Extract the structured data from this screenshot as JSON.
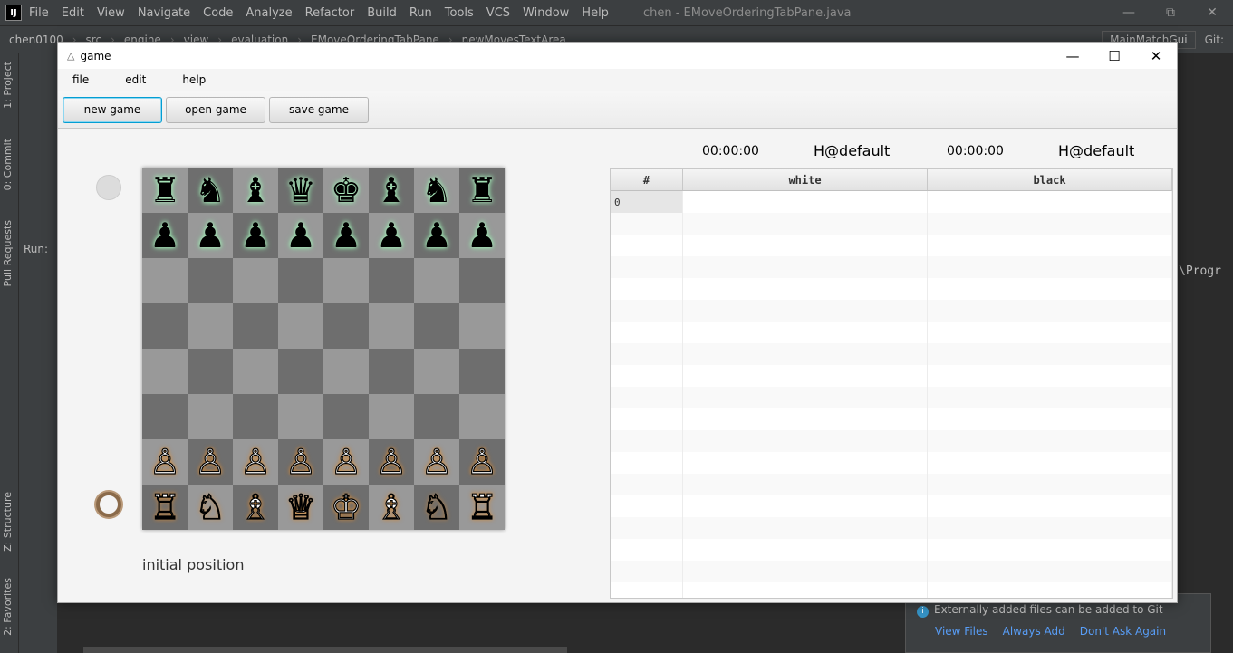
{
  "ide": {
    "logo": "IJ",
    "menu": [
      "File",
      "Edit",
      "View",
      "Navigate",
      "Code",
      "Analyze",
      "Refactor",
      "Build",
      "Run",
      "Tools",
      "VCS",
      "Window",
      "Help"
    ],
    "title": "chen - EMoveOrderingTabPane.java",
    "breadcrumbs": [
      "chen0100",
      "src",
      "engine",
      "view",
      "evaluation",
      "EMoveOrderingTabPane",
      "newMovesTextArea"
    ],
    "run_config": "MainMatchGui",
    "git_label": "Git:",
    "vtabs": {
      "project": "1: Project",
      "commit": "0: Commit",
      "pull": "Pull Requests",
      "structure": "Z: Structure",
      "favorites": "2: Favorites"
    },
    "panel_label": "Run:",
    "editor_snippet": "\\Progr",
    "notification": {
      "text": "Externally added files can be added to Git",
      "links": [
        "View Files",
        "Always Add",
        "Don't Ask Again"
      ]
    }
  },
  "game": {
    "title": "game",
    "menu": {
      "file": "file",
      "edit": "edit",
      "help": "help"
    },
    "toolbar": {
      "new_game": "new game",
      "open_game": "open game",
      "save_game": "save game"
    },
    "white_clock": "00:00:00",
    "white_player": "H@default",
    "black_clock": "00:00:00",
    "black_player": "H@default",
    "status": "initial position",
    "board": [
      [
        "♜",
        "♞",
        "♝",
        "♛",
        "♚",
        "♝",
        "♞",
        "♜"
      ],
      [
        "♟",
        "♟",
        "♟",
        "♟",
        "♟",
        "♟",
        "♟",
        "♟"
      ],
      [
        "",
        "",
        "",
        "",
        "",
        "",
        "",
        ""
      ],
      [
        "",
        "",
        "",
        "",
        "",
        "",
        "",
        ""
      ],
      [
        "",
        "",
        "",
        "",
        "",
        "",
        "",
        ""
      ],
      [
        "",
        "",
        "",
        "",
        "",
        "",
        "",
        ""
      ],
      [
        "♙",
        "♙",
        "♙",
        "♙",
        "♙",
        "♙",
        "♙",
        "♙"
      ],
      [
        "♖",
        "♘",
        "♗",
        "♕",
        "♔",
        "♗",
        "♘",
        "♖"
      ]
    ],
    "moves_table": {
      "headers": {
        "num": "#",
        "white": "white",
        "black": "black"
      },
      "rows": [
        {
          "num": "0",
          "white": "",
          "black": ""
        }
      ]
    }
  }
}
